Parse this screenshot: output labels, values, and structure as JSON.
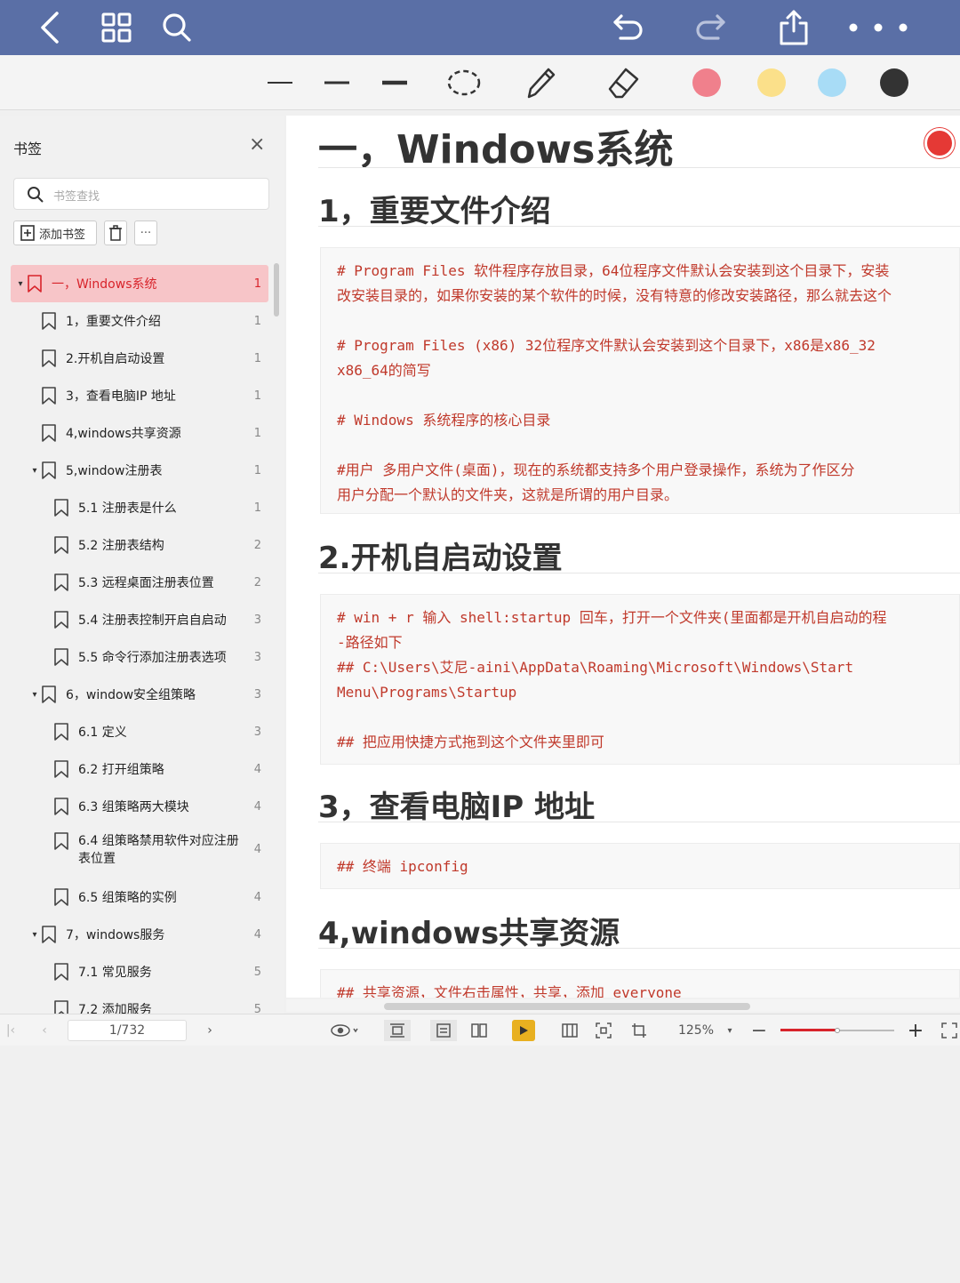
{
  "topbar": {
    "icons": [
      "back-icon",
      "grid-icon",
      "search-icon",
      "undo-icon",
      "redo-icon",
      "share-icon",
      "more-icon"
    ]
  },
  "pen_toolbar": {
    "tools": [
      "line-thin",
      "line-medium",
      "line-thick",
      "lasso",
      "pencil",
      "eraser"
    ],
    "colors": [
      "#f0808c",
      "#fbe08a",
      "#a8dcf6",
      "#333333"
    ]
  },
  "sidebar": {
    "title": "书签",
    "search_placeholder": "书签查找",
    "add_label": "添加书签",
    "items": [
      {
        "label": "一，Windows系统",
        "page": "1",
        "level": 0,
        "expanded": true,
        "selected": true
      },
      {
        "label": "1，重要文件介绍",
        "page": "1",
        "level": 1
      },
      {
        "label": "2.开机自启动设置",
        "page": "1",
        "level": 1
      },
      {
        "label": "3，查看电脑IP 地址",
        "page": "1",
        "level": 1
      },
      {
        "label": "4,windows共享资源",
        "page": "1",
        "level": 1
      },
      {
        "label": "5,window注册表",
        "page": "1",
        "level": 1,
        "expanded": true
      },
      {
        "label": "5.1 注册表是什么",
        "page": "1",
        "level": 2
      },
      {
        "label": "5.2 注册表结构",
        "page": "2",
        "level": 2
      },
      {
        "label": "5.3 远程桌面注册表位置",
        "page": "2",
        "level": 2
      },
      {
        "label": "5.4 注册表控制开启自启动",
        "page": "3",
        "level": 2
      },
      {
        "label": "5.5 命令行添加注册表选项",
        "page": "3",
        "level": 2
      },
      {
        "label": "6，window安全组策略",
        "page": "3",
        "level": 1,
        "expanded": true
      },
      {
        "label": "6.1 定义",
        "page": "3",
        "level": 2
      },
      {
        "label": "6.2 打开组策略",
        "page": "4",
        "level": 2
      },
      {
        "label": "6.3 组策略两大模块",
        "page": "4",
        "level": 2
      },
      {
        "label": "6.4 组策略禁用软件对应注册表位置",
        "page": "4",
        "level": 2,
        "tall": true
      },
      {
        "label": "6.5 组策略的实例",
        "page": "4",
        "level": 2
      },
      {
        "label": "7，windows服务",
        "page": "4",
        "level": 1,
        "expanded": true
      },
      {
        "label": "7.1 常见服务",
        "page": "5",
        "level": 2
      },
      {
        "label": "7.2 添加服务",
        "page": "5",
        "level": 2
      }
    ]
  },
  "document": {
    "h1": "一，Windows系统",
    "sections": [
      {
        "heading": "1，重要文件介绍",
        "code": [
          "# Program Files 软件程序存放目录，64位程序文件默认会安装到这个目录下，安装",
          "改安装目录的，如果你安装的某个软件的时候，没有特意的修改安装路径，那么就去这个",
          "",
          "# Program Files (x86)   32位程序文件默认会安装到这个目录下，x86是x86_32",
          "x86_64的简写",
          "",
          "# Windows    系统程序的核心目录",
          "",
          "#用户      多用户文件(桌面)，现在的系统都支持多个用户登录操作，系统为了作区分",
          "用户分配一个默认的文件夹，这就是所谓的用户目录。"
        ]
      },
      {
        "heading": "2.开机自启动设置",
        "code": [
          "# win + r 输入 shell:startup 回车，打开一个文件夹(里面都是开机自启动的程",
          "-路径如下",
          "## C:\\Users\\艾尼-aini\\AppData\\Roaming\\Microsoft\\Windows\\Start",
          "Menu\\Programs\\Startup",
          "",
          "## 把应用快捷方式拖到这个文件夹里即可"
        ]
      },
      {
        "heading": "3，查看电脑IP 地址",
        "code": [
          "## 终端  ipconfig"
        ]
      },
      {
        "heading": "4,windows共享资源",
        "code": [
          "## 共享资源，文件右击属性，共享，添加 everyone"
        ]
      }
    ]
  },
  "statusbar": {
    "page_indicator": "1/732",
    "zoom": "125%",
    "zoom_level": 0.5
  }
}
